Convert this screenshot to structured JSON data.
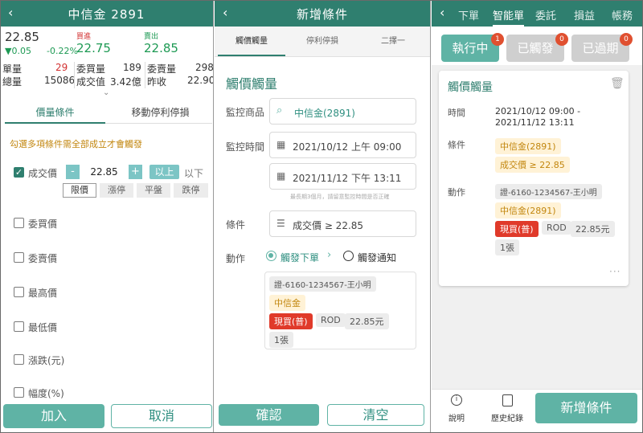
{
  "panel1": {
    "title": "中信金 2891",
    "last_price": "22.85",
    "change": "▼0.05",
    "change_pct": "-0.22%",
    "buy_label": "買進",
    "buy_price": "22.75",
    "sell_label": "賣出",
    "sell_price": "22.85",
    "stats": [
      {
        "l1": "單量",
        "v1": "29",
        "l2": "委買量",
        "v2": "189",
        "l3": "委賣量",
        "v3": "298"
      },
      {
        "l1": "總量",
        "v1": "15086",
        "l2": "成交值",
        "v2": "3.42億",
        "l3": "昨收",
        "v3": "22.90"
      }
    ],
    "tabs": [
      "價量條件",
      "移動停利停損"
    ],
    "hint": "勾選多項條件需全部成立才會觸發",
    "conditions": [
      {
        "label": "成交價",
        "checked": true
      },
      {
        "label": "委買價",
        "checked": false
      },
      {
        "label": "委賣價",
        "checked": false
      },
      {
        "label": "最高價",
        "checked": false
      },
      {
        "label": "最低價",
        "checked": false
      },
      {
        "label": "漲跌(元)",
        "checked": false
      },
      {
        "label": "幅度(%)",
        "checked": false
      }
    ],
    "stepper_value": "22.85",
    "minus": "-",
    "plus": "+",
    "above": "以上",
    "below": "以下",
    "price_types": [
      "限價",
      "漲停",
      "平盤",
      "跌停"
    ],
    "join_button": "加入",
    "cancel_button": "取消"
  },
  "panel2": {
    "title": "新增條件",
    "tabs": [
      "觸價觸量",
      "停利停損",
      "二擇一"
    ],
    "section_title": "觸價觸量",
    "monitor_product_label": "監控商品",
    "monitor_product": "中信金(2891)",
    "monitor_time_label": "監控時間",
    "start_time": "2021/10/12 上午 09:00",
    "end_time": "2021/11/12 下午 13:11",
    "time_note": "最長期3個月，請留意監控時間是否正確",
    "condition_label": "條件",
    "condition_value": "成交價 ≥ 22.85",
    "action_label": "動作",
    "option_order": "觸發下單",
    "option_notify": "觸發通知",
    "order": {
      "account": "證-6160-1234567-王小明",
      "stock": "中信金",
      "side": "現買(普)",
      "type": "ROD",
      "price": "22.85元",
      "qty": "1張"
    },
    "confirm_button": "確認",
    "clear_button": "清空"
  },
  "panel3": {
    "tabs": [
      "下單",
      "智能單",
      "委託",
      "損益",
      "帳務"
    ],
    "filters": [
      {
        "label": "執行中",
        "count": "1"
      },
      {
        "label": "已觸發",
        "count": "0"
      },
      {
        "label": "已過期",
        "count": "0"
      }
    ],
    "card": {
      "title": "觸價觸量",
      "time_label": "時間",
      "time_value": "2021/10/12 09:00 -",
      "time_value2": "2021/11/12 13:11",
      "cond_label": "條件",
      "cond_stock": "中信金(2891)",
      "cond_rule": "成交價 ≥ 22.85",
      "action_label": "動作",
      "account": "證-6160-1234567-王小明",
      "stock": "中信金(2891)",
      "side": "現買(普)",
      "type": "ROD",
      "price": "22.85元",
      "qty": "1張",
      "more": "···"
    },
    "bottom_help": "說明",
    "bottom_history": "歷史紀錄",
    "add_button": "新增條件"
  }
}
